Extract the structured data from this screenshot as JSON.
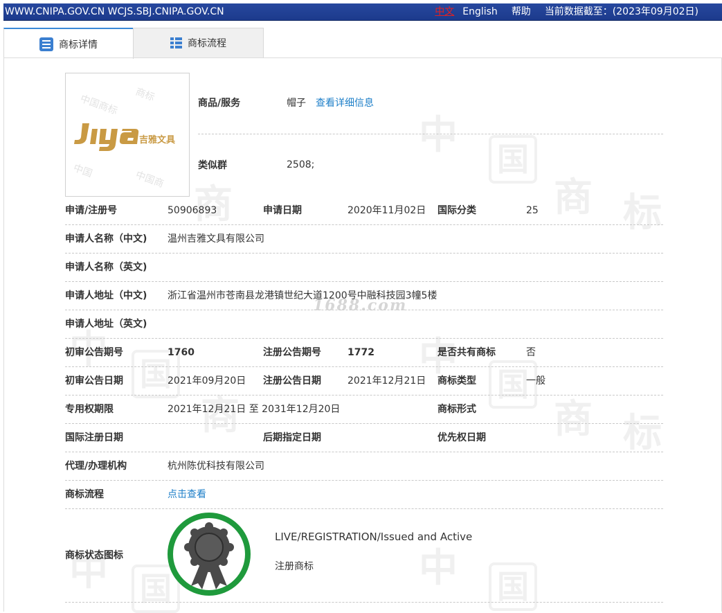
{
  "topbar": {
    "site": "WWW.CNIPA.GOV.CN WCJS.SBJ.CNIPA.GOV.CN",
    "lang_cn": "中文",
    "lang_en": "English",
    "help": "帮助",
    "data_as_of": "当前数据截至：(2023年09月02日)"
  },
  "tabs": [
    {
      "label": "商标详情"
    },
    {
      "label": "商标流程"
    }
  ],
  "logo": {
    "brand_text": "吉雅文具"
  },
  "goods": {
    "label": "商品/服务",
    "value": "帽子",
    "detail_link": "查看详细信息"
  },
  "similar_group": {
    "label": "类似群",
    "value": "2508;"
  },
  "fields": {
    "reg_no": {
      "label": "申请/注册号",
      "value": "50906893"
    },
    "app_date": {
      "label": "申请日期",
      "value": "2020年11月02日"
    },
    "intl_class": {
      "label": "国际分类",
      "value": "25"
    },
    "applicant_cn": {
      "label": "申请人名称（中文)",
      "value": "温州吉雅文具有限公司"
    },
    "applicant_en": {
      "label": "申请人名称（英文)",
      "value": ""
    },
    "address_cn": {
      "label": "申请人地址（中文)",
      "value": "浙江省温州市苍南县龙港镇世纪大道1200号中融科技园3幢5楼"
    },
    "address_en": {
      "label": "申请人地址（英文)",
      "value": ""
    },
    "prelim_issue": {
      "label": "初审公告期号",
      "value": "1760"
    },
    "reg_issue": {
      "label": "注册公告期号",
      "value": "1772"
    },
    "shared": {
      "label": "是否共有商标",
      "value": "否"
    },
    "prelim_date": {
      "label": "初审公告日期",
      "value": "2021年09月20日"
    },
    "reg_date": {
      "label": "注册公告日期",
      "value": "2021年12月21日"
    },
    "mark_type": {
      "label": "商标类型",
      "value": "一般"
    },
    "exclusive_period": {
      "label": "专用权期限",
      "value": "2021年12月21日 至 2031年12月20日"
    },
    "mark_form": {
      "label": "商标形式",
      "value": ""
    },
    "intl_reg_date": {
      "label": "国际注册日期",
      "value": ""
    },
    "later_designation": {
      "label": "后期指定日期",
      "value": ""
    },
    "priority_date": {
      "label": "优先权日期",
      "value": ""
    },
    "agent": {
      "label": "代理/办理机构",
      "value": "杭州陈优科技有限公司"
    },
    "process": {
      "label": "商标流程",
      "value": "点击查看"
    }
  },
  "status": {
    "label": "商标状态图标",
    "en": "LIVE/REGISTRATION/Issued and Active",
    "cn": "注册商标"
  },
  "watermark": {
    "site": "1688.com"
  },
  "colors": {
    "topbar": "#1c3a8c",
    "link": "#1e7fc8",
    "badge_ring": "#1f9a3c",
    "tab_accent": "#3a8ad8"
  }
}
